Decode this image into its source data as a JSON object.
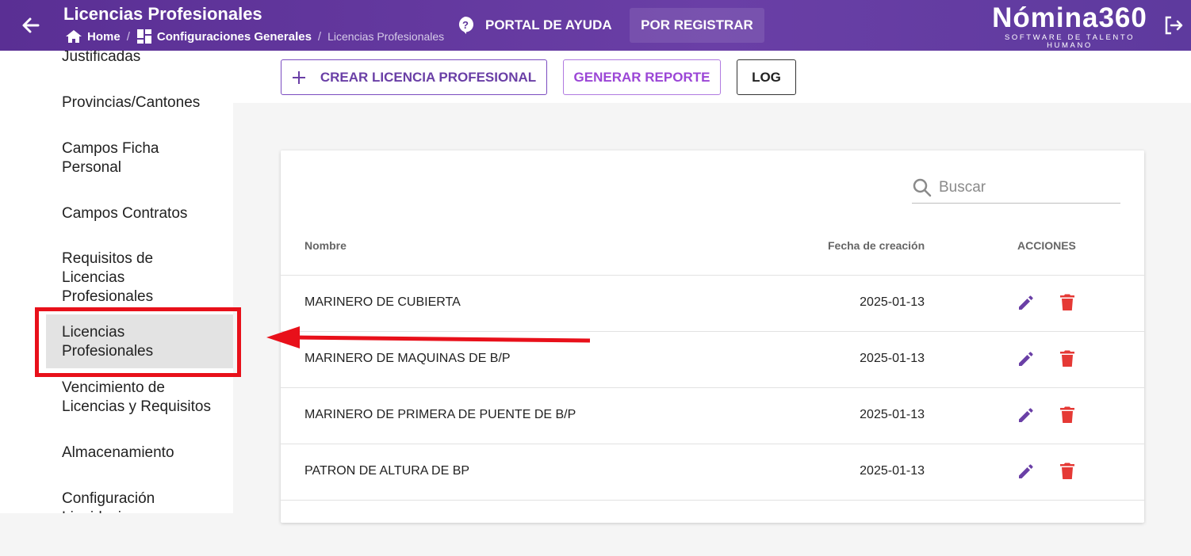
{
  "header": {
    "title": "Licencias Profesionales",
    "breadcrumb": {
      "home": "Home",
      "section": "Configuraciones Generales",
      "current": "Licencias Profesionales"
    },
    "help_label": "PORTAL DE AYUDA",
    "register_label": "POR REGISTRAR",
    "logo": {
      "main": "Nómina360",
      "tagline": "SOFTWARE DE TALENTO HUMANO"
    }
  },
  "sidebar": {
    "items": [
      {
        "label": "Justificadas"
      },
      {
        "label": "Provincias/Cantones"
      },
      {
        "label": "Campos Ficha Personal"
      },
      {
        "label": "Campos Contratos"
      },
      {
        "label": "Requisitos de Licencias Profesionales"
      },
      {
        "label": "Licencias Profesionales",
        "active": true
      },
      {
        "label": "Vencimiento de Licencias y Requisitos"
      },
      {
        "label": "Almacenamiento"
      },
      {
        "label": "Configuración Liquidaciones"
      }
    ]
  },
  "toolbar": {
    "create_label": "CREAR LICENCIA PROFESIONAL",
    "report_label": "GENERAR REPORTE",
    "log_label": "LOG"
  },
  "search": {
    "placeholder": "Buscar"
  },
  "table": {
    "columns": [
      "Nombre",
      "Fecha de creación",
      "ACCIONES"
    ],
    "rows": [
      {
        "name": "MARINERO DE CUBIERTA",
        "date": "2025-01-13"
      },
      {
        "name": "MARINERO DE MAQUINAS DE B/P",
        "date": "2025-01-13"
      },
      {
        "name": "MARINERO DE PRIMERA DE PUENTE DE B/P",
        "date": "2025-01-13"
      },
      {
        "name": "PATRON DE ALTURA DE BP",
        "date": "2025-01-13"
      }
    ]
  },
  "colors": {
    "header_purple": "#5e3599",
    "accent_purple": "#6a3fa6",
    "delete_red": "#e53935",
    "annotation_red": "#e8101a"
  }
}
